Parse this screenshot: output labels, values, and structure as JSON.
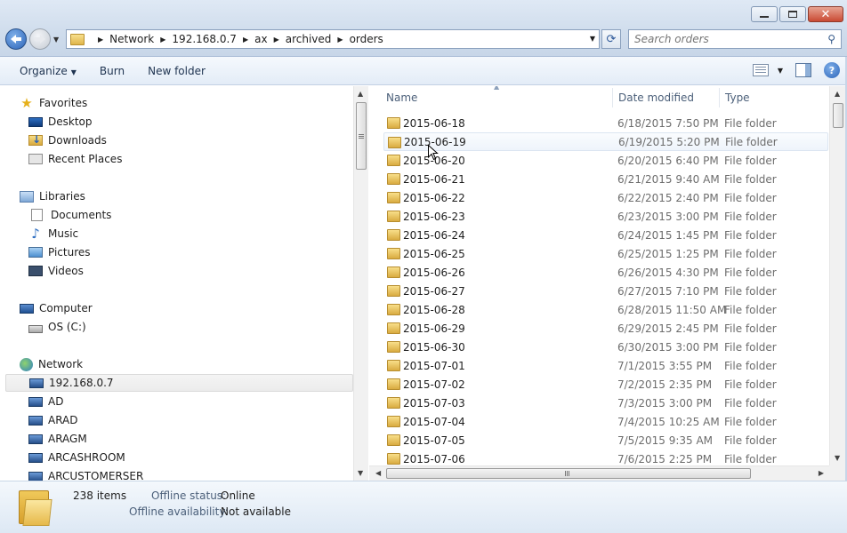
{
  "address": {
    "crumbs": [
      "Network",
      "192.168.0.7",
      "ax",
      "archived",
      "orders"
    ]
  },
  "search": {
    "placeholder": "Search orders"
  },
  "toolbar": {
    "organize": "Organize",
    "burn": "Burn",
    "new_folder": "New folder"
  },
  "nav": {
    "favorites": {
      "label": "Favorites",
      "items": [
        "Desktop",
        "Downloads",
        "Recent Places"
      ]
    },
    "libraries": {
      "label": "Libraries",
      "items": [
        "Documents",
        "Music",
        "Pictures",
        "Videos"
      ]
    },
    "computer": {
      "label": "Computer",
      "items": [
        "OS (C:)"
      ]
    },
    "network": {
      "label": "Network",
      "items": [
        "192.168.0.7",
        "AD",
        "ARAD",
        "ARAGM",
        "ARCASHROOM",
        "ARCUSTOMERSER"
      ]
    }
  },
  "columns": {
    "name": "Name",
    "date": "Date modified",
    "type": "Type"
  },
  "files": [
    {
      "name": "2015-06-18",
      "date": "6/18/2015 7:50 PM",
      "type": "File folder"
    },
    {
      "name": "2015-06-19",
      "date": "6/19/2015 5:20 PM",
      "type": "File folder"
    },
    {
      "name": "2015-06-20",
      "date": "6/20/2015 6:40 PM",
      "type": "File folder"
    },
    {
      "name": "2015-06-21",
      "date": "6/21/2015 9:40 AM",
      "type": "File folder"
    },
    {
      "name": "2015-06-22",
      "date": "6/22/2015 2:40 PM",
      "type": "File folder"
    },
    {
      "name": "2015-06-23",
      "date": "6/23/2015 3:00 PM",
      "type": "File folder"
    },
    {
      "name": "2015-06-24",
      "date": "6/24/2015 1:45 PM",
      "type": "File folder"
    },
    {
      "name": "2015-06-25",
      "date": "6/25/2015 1:25 PM",
      "type": "File folder"
    },
    {
      "name": "2015-06-26",
      "date": "6/26/2015 4:30 PM",
      "type": "File folder"
    },
    {
      "name": "2015-06-27",
      "date": "6/27/2015 7:10 PM",
      "type": "File folder"
    },
    {
      "name": "2015-06-28",
      "date": "6/28/2015 11:50 AM",
      "type": "File folder"
    },
    {
      "name": "2015-06-29",
      "date": "6/29/2015 2:45 PM",
      "type": "File folder"
    },
    {
      "name": "2015-06-30",
      "date": "6/30/2015 3:00 PM",
      "type": "File folder"
    },
    {
      "name": "2015-07-01",
      "date": "7/1/2015 3:55 PM",
      "type": "File folder"
    },
    {
      "name": "2015-07-02",
      "date": "7/2/2015 2:35 PM",
      "type": "File folder"
    },
    {
      "name": "2015-07-03",
      "date": "7/3/2015 3:00 PM",
      "type": "File folder"
    },
    {
      "name": "2015-07-04",
      "date": "7/4/2015 10:25 AM",
      "type": "File folder"
    },
    {
      "name": "2015-07-05",
      "date": "7/5/2015 9:35 AM",
      "type": "File folder"
    },
    {
      "name": "2015-07-06",
      "date": "7/6/2015 2:25 PM",
      "type": "File folder"
    }
  ],
  "details": {
    "count": "238 items",
    "offline_status_label": "Offline status:",
    "offline_status": "Online",
    "offline_avail_label": "Offline availability:",
    "offline_avail": "Not available"
  },
  "colors": {
    "accent": "#2c64b8",
    "selection": "#eef4fb",
    "folder": "#d9ab40"
  }
}
